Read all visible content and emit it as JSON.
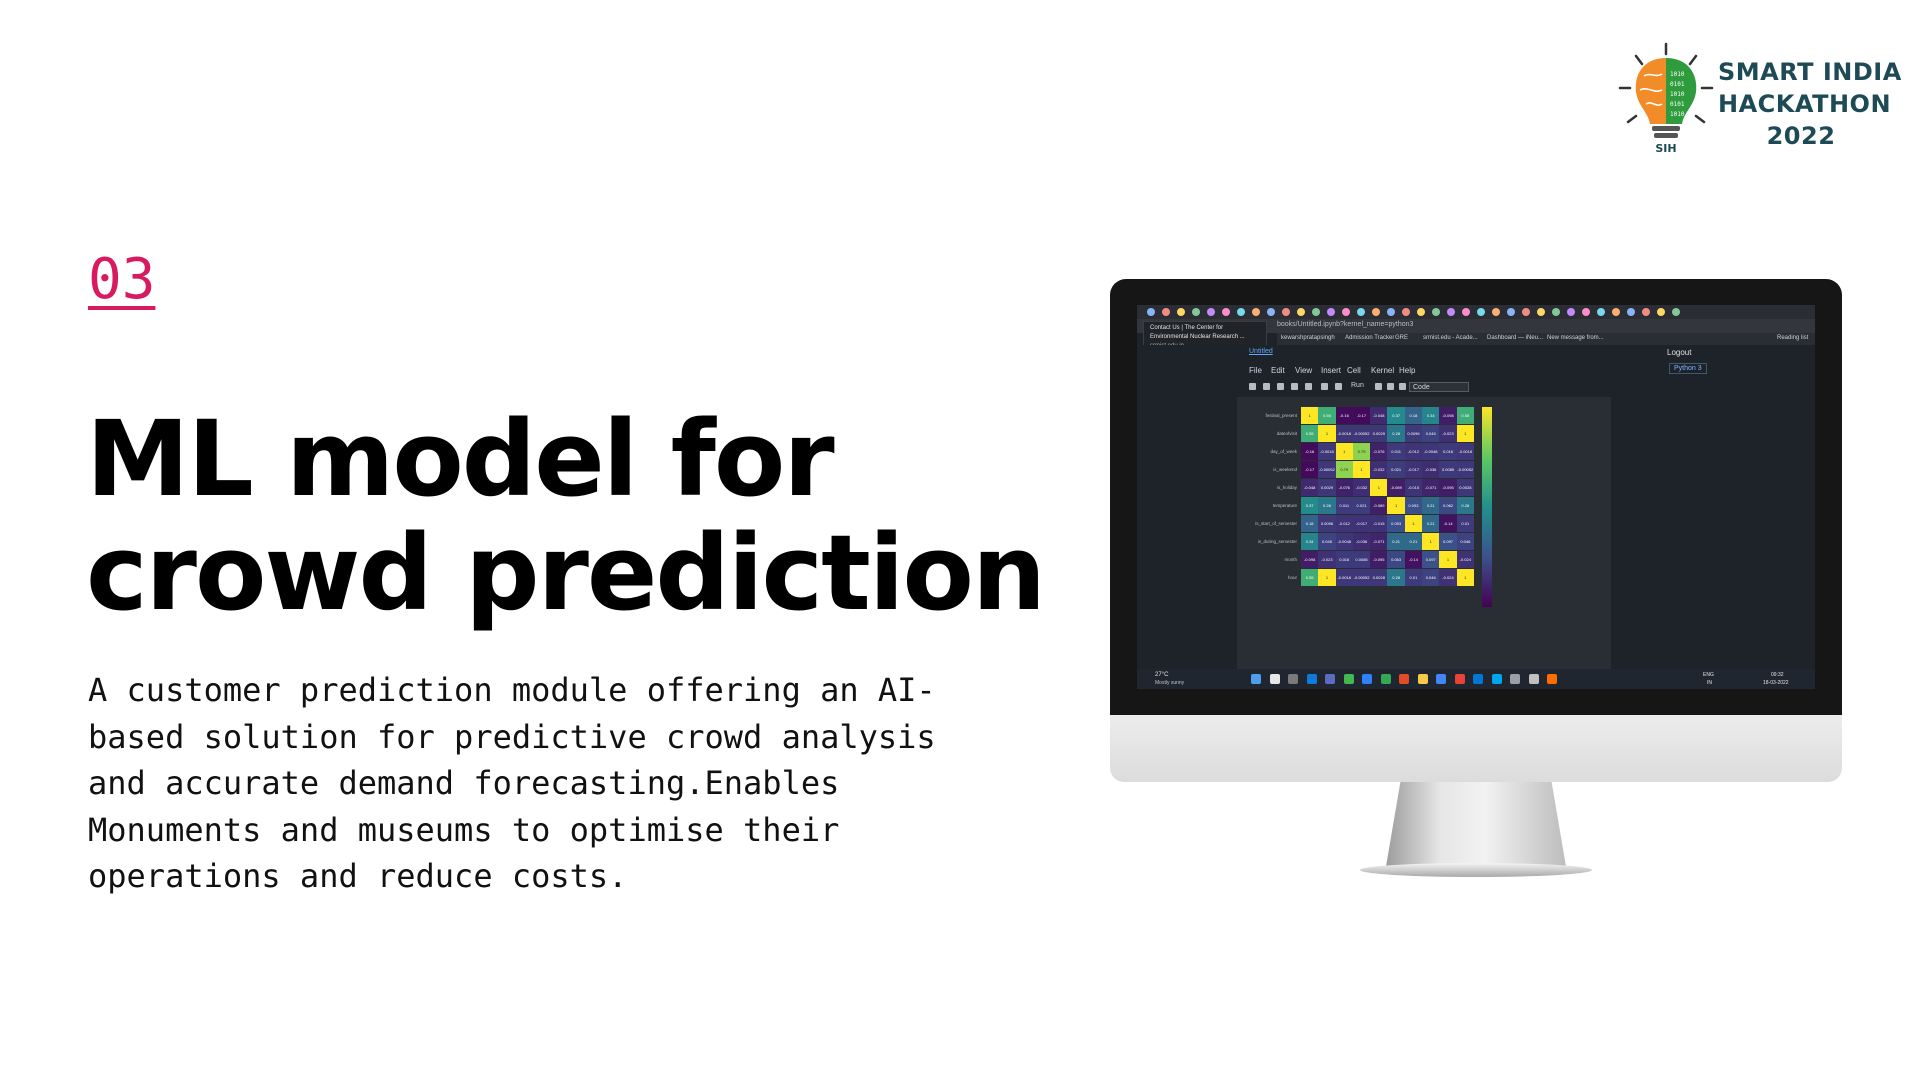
{
  "logo": {
    "emblem_text": "SIH",
    "line1": "SMART INDIA",
    "line2": "HACKATHON",
    "line3": "2022"
  },
  "section": {
    "number": "03",
    "title_line1": "ML model for",
    "title_line2": "crowd prediction",
    "description": "A customer prediction module offering an AI-based solution for predictive crowd analysis and accurate demand forecasting.Enables Monuments and museums to optimise their operations and reduce costs."
  },
  "colors": {
    "accent": "#d81b60",
    "logo_text": "#1d4a55",
    "logo_green": "#2e9b3c",
    "logo_orange": "#f28c28"
  },
  "screenshot": {
    "address": "books/Untitled.ipynb?kernel_name=python3",
    "tooltip_title": "Contact Us | The Center for",
    "tooltip_sub": "Environmental Nuclear Research ...",
    "tooltip_url": "srmist.edu.in",
    "bookmarks": [
      "kewarshpratapsingh",
      "Admission Tracker",
      "GRE",
      "srmist.edu - Acade...",
      "Dashboard — iNeu...",
      "New message from...",
      "Reading list"
    ],
    "jupyter_link": "Untitled",
    "logout": "Logout",
    "menu": [
      "File",
      "Edit",
      "View",
      "Insert",
      "Cell",
      "Kernel",
      "Help"
    ],
    "kernel": "Python 3",
    "run_label": "Run",
    "cell_type": "Code",
    "heatmap_row_labels": [
      "festival_present",
      "dateofvisit",
      "day_of_week",
      "is_weekend",
      "is_holiday",
      "temperature",
      "is_start_of_semester",
      "is_during_semester",
      "month",
      "hour"
    ],
    "heatmap_values": [
      [
        "1",
        "0.55",
        "-0.16",
        "-0.17",
        "-0.048",
        "0.37",
        "0.18",
        "0.34",
        "-0.098",
        "0.55"
      ],
      [
        "0.55",
        "1",
        "-0.0018",
        "-0.00052",
        "0.0029",
        "0.28",
        "0.0096",
        "0.045",
        "-0.023",
        "1"
      ],
      [
        "-0.16",
        "-0.0018",
        "1",
        "0.79",
        "-0.076",
        "0.011",
        "-0.012",
        "-0.0048",
        "0.016",
        "-0.0018"
      ],
      [
        "-0.17",
        "-0.00052",
        "0.79",
        "1",
        "-0.032",
        "0.021",
        "-0.017",
        "-0.036",
        "0.0085",
        "-0.00052"
      ],
      [
        "-0.048",
        "0.0029",
        "-0.076",
        "-0.032",
        "1",
        "-0.089",
        "-0.015",
        "-0.071",
        "-0.095",
        "0.0028"
      ],
      [
        "0.37",
        "0.28",
        "0.011",
        "0.021",
        "-0.089",
        "1",
        "0.093",
        "0.21",
        "0.062",
        "0.28"
      ],
      [
        "0.18",
        "0.0096",
        "-0.012",
        "-0.017",
        "-0.015",
        "0.093",
        "1",
        "0.21",
        "-0.14",
        "0.01"
      ],
      [
        "0.34",
        "0.045",
        "-0.0048",
        "-0.036",
        "-0.071",
        "0.21",
        "0.21",
        "1",
        "0.097",
        "0.046"
      ],
      [
        "-0.098",
        "-0.023",
        "0.016",
        "0.0085",
        "-0.095",
        "0.063",
        "-0.14",
        "0.097",
        "1",
        "-0.024"
      ],
      [
        "0.55",
        "1",
        "-0.0018",
        "-0.00052",
        "0.0028",
        "0.28",
        "0.01",
        "0.046",
        "-0.024",
        "1"
      ]
    ],
    "weather_temp": "27°C",
    "weather_desc": "Mostly sunny",
    "language": "ENG",
    "region": "IN",
    "time": "09:32",
    "date": "18-03-2022"
  }
}
